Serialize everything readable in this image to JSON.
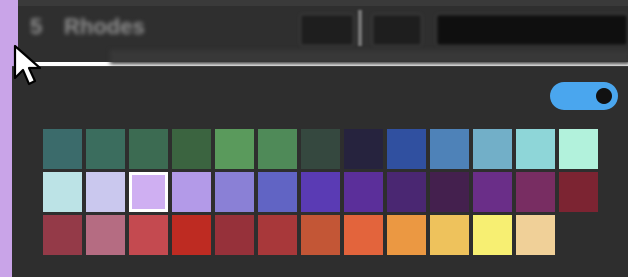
{
  "track": {
    "number": "5",
    "name": "Rhodes",
    "color": "#c9a4e8"
  },
  "popup": {
    "toggle": {
      "state": "on",
      "color": "#4aa6ee"
    },
    "selected": {
      "row": 1,
      "col": 2
    },
    "rows": [
      [
        "#3b6b6b",
        "#3b6d5e",
        "#3c6b52",
        "#3b6440",
        "#5a9a5c",
        "#4f8a58",
        "#35483f",
        "#26233e",
        "#3050a0",
        "#4e82b8",
        "#72afc8",
        "#8ed6d8",
        "#b2f2dc"
      ],
      [
        "#bce3e6",
        "#cac8ee",
        "#cfaff2",
        "#b39ae8",
        "#8a80d6",
        "#6164c4",
        "#5a3bb4",
        "#5b2f9a",
        "#4a2772",
        "#44204e",
        "#6a2e88",
        "#782d62",
        "#7c2432"
      ],
      [
        "#943a48",
        "#b56c82",
        "#c44a50",
        "#be2b22",
        "#96313a",
        "#a8383a",
        "#c35636",
        "#e3643c",
        "#eb9842",
        "#eec25c",
        "#f7ef72",
        "#f0d098"
      ]
    ]
  },
  "cursor": {
    "type": "arrow-icon"
  }
}
